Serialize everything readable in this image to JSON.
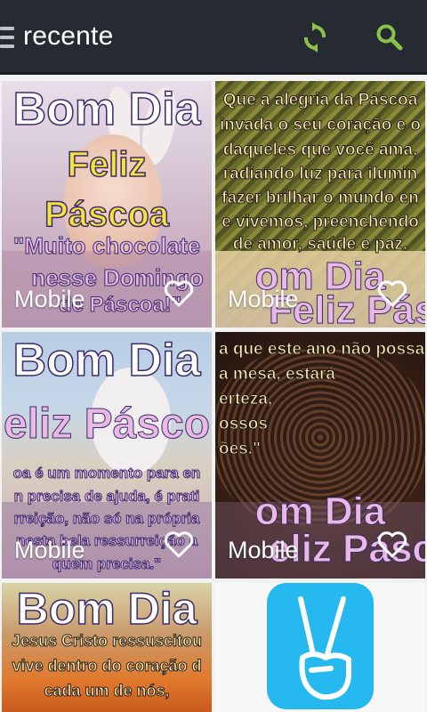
{
  "appbar": {
    "title": "recente",
    "icons": {
      "menu": "hamburger-icon",
      "refresh": "refresh-icon",
      "search": "search-icon"
    },
    "colors": {
      "background": "#262b31",
      "accent": "#8bc34a"
    }
  },
  "cards": [
    {
      "category": "Mobile",
      "favorite_icon": "heart-outline-icon",
      "text": {
        "heading": "Bom Dia",
        "line1": "Feliz",
        "line2": "Páscoa",
        "line3": "\"Muito chocolate",
        "line4": "nesse Domingo",
        "line5": "de Páscoa!\""
      }
    },
    {
      "category": "Mobile",
      "favorite_icon": "heart-outline-icon",
      "text": {
        "line1": "Que a alegria da Páscoa",
        "line2": "invada o seu coração e o",
        "line3": "daqueles que você ama,",
        "line4": "radiando luz para ilumin",
        "line5": "fazer brilhar o mundo en",
        "line6": "e vivemos, preenchendo",
        "line7": "de amor, saúde e paz.",
        "heading": "om Dia",
        "footer": "Feliz Pásco"
      }
    },
    {
      "category": "Mobile",
      "favorite_icon": "heart-outline-icon",
      "text": {
        "heading": "Bom Dia",
        "line1": "eliz Pásco",
        "line2": "oa é um momento para en",
        "line3": "n precisa de ajuda, é prati",
        "line4": "rreição, não só na própria",
        "line5": "nesta bela ressurreição a",
        "line6": "quem precisa.\""
      }
    },
    {
      "category": "Mobile",
      "favorite_icon": "heart-outline-icon",
      "text": {
        "line1": "a que este ano não possa",
        "line2": "a mesa, estará",
        "line3": "erteza,",
        "line4": "ossos",
        "line5": "ões.\"",
        "heading": "om Dia",
        "footer": "eliz Pásc"
      }
    },
    {
      "text": {
        "heading": "Bom Dia",
        "line1": "Jesus Cristo ressuscitou",
        "line2": "vive dentro do coração d",
        "line3": "cada um de nós,"
      }
    },
    {
      "type": "ad",
      "icon": "peace-hand-icon",
      "colors": {
        "background": "#25b9f0"
      }
    }
  ]
}
